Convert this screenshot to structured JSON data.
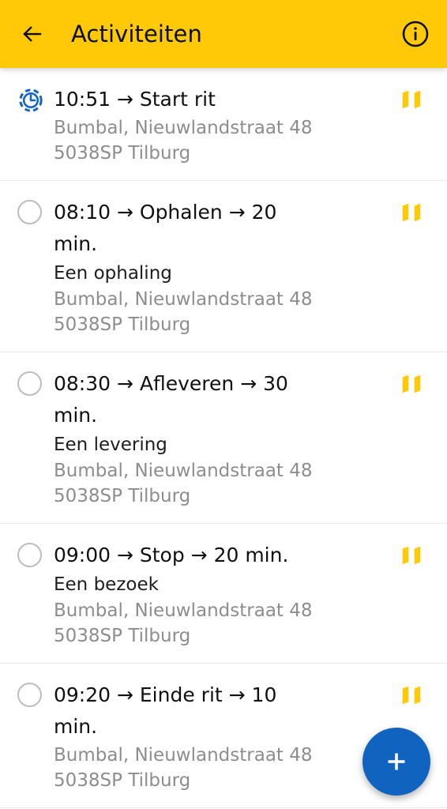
{
  "appbar": {
    "back_label": "back-arrow",
    "title": "Activiteiten",
    "info_label": "info"
  },
  "list": {
    "items": [
      {
        "status": "in-progress",
        "status_icon": "clock-dashed-icon",
        "title": "10:51 → Start rit",
        "subtitle": "",
        "address_line1": "Bumbal, Nieuwlandstraat 48",
        "address_line2": "5038SP Tilburg",
        "map_icon": "map-icon"
      },
      {
        "status": "pending",
        "status_icon": "circle-outline-icon",
        "title": "08:10 → Ophalen → 20 min.",
        "subtitle": "Een ophaling",
        "address_line1": "Bumbal, Nieuwlandstraat 48",
        "address_line2": "5038SP Tilburg",
        "map_icon": "map-icon"
      },
      {
        "status": "pending",
        "status_icon": "circle-outline-icon",
        "title": "08:30 → Afleveren → 30 min.",
        "subtitle": "Een levering",
        "address_line1": "Bumbal, Nieuwlandstraat 48",
        "address_line2": "5038SP Tilburg",
        "map_icon": "map-icon"
      },
      {
        "status": "pending",
        "status_icon": "circle-outline-icon",
        "title": "09:00 → Stop → 20 min.",
        "subtitle": "Een bezoek",
        "address_line1": "Bumbal, Nieuwlandstraat 48",
        "address_line2": "5038SP Tilburg",
        "map_icon": "map-icon"
      },
      {
        "status": "pending",
        "status_icon": "circle-outline-icon",
        "title": "09:20 → Einde rit → 10 min.",
        "subtitle": "",
        "address_line1": "Bumbal, Nieuwlandstraat 48",
        "address_line2": "5038SP Tilburg",
        "map_icon": "map-icon"
      }
    ]
  },
  "fab": {
    "icon": "plus-icon",
    "label": "+"
  },
  "colors": {
    "appbar_background": "#FFC907",
    "map_icon": "#FFC907",
    "status_active": "#1565C0",
    "status_pending": "#BDBDBD",
    "fab_background": "#1064C0",
    "primary_text": "#101010",
    "secondary_text": "#8D8D8D",
    "divider": "#E9E9E9"
  }
}
